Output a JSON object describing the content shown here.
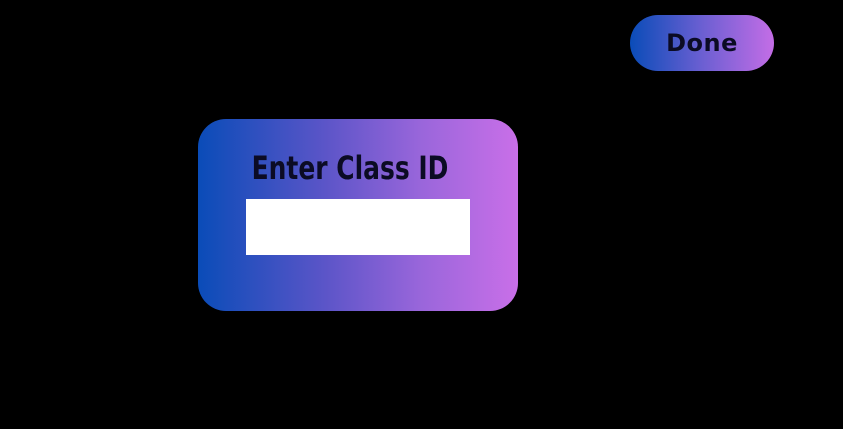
{
  "header": {
    "done_label": "Done"
  },
  "class_form": {
    "title": "Enter Class ID",
    "input_value": "",
    "input_placeholder": ""
  },
  "colors": {
    "background": "#000000",
    "gradient_start": "#0a4cb8",
    "gradient_end": "#c96fe8",
    "text_dark": "#0b0b24",
    "input_background": "#ffffff"
  }
}
